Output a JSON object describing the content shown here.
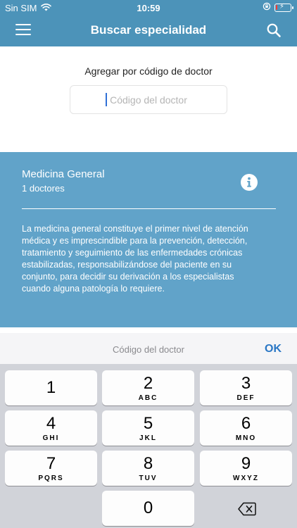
{
  "status_bar": {
    "carrier": "Sin SIM",
    "time": "10:59",
    "battery_level": 0.12
  },
  "nav": {
    "title": "Buscar especialidad"
  },
  "add_by_code": {
    "label": "Agregar por código de doctor",
    "placeholder": "Código del doctor",
    "value": ""
  },
  "specialty": {
    "name": "Medicina General",
    "count": "1 doctores",
    "description": "La medicina general constituye el primer nivel de atención médica y es imprescindible para la prevención, detección, tratamiento y seguimiento de las enfermedades crónicas estabilizadas, responsabilizándose del paciente en su conjunto, para decidir su derivación a los especialistas cuando alguna patología lo requiere."
  },
  "keyboard": {
    "accessory_label": "Código del doctor",
    "ok_label": "OK",
    "keys": [
      {
        "num": "1",
        "letters": ""
      },
      {
        "num": "2",
        "letters": "ABC"
      },
      {
        "num": "3",
        "letters": "DEF"
      },
      {
        "num": "4",
        "letters": "GHI"
      },
      {
        "num": "5",
        "letters": "JKL"
      },
      {
        "num": "6",
        "letters": "MNO"
      },
      {
        "num": "7",
        "letters": "PQRS"
      },
      {
        "num": "8",
        "letters": "TUV"
      },
      {
        "num": "9",
        "letters": "WXYZ"
      },
      {
        "num": "0",
        "letters": ""
      }
    ]
  },
  "colors": {
    "header": "#4c93b9",
    "card": "#61a3c9",
    "accent": "#2a77c5"
  },
  "icons": [
    "wifi-icon",
    "orientation-lock-icon",
    "battery-icon",
    "menu-icon",
    "search-icon",
    "info-icon",
    "delete-icon"
  ]
}
